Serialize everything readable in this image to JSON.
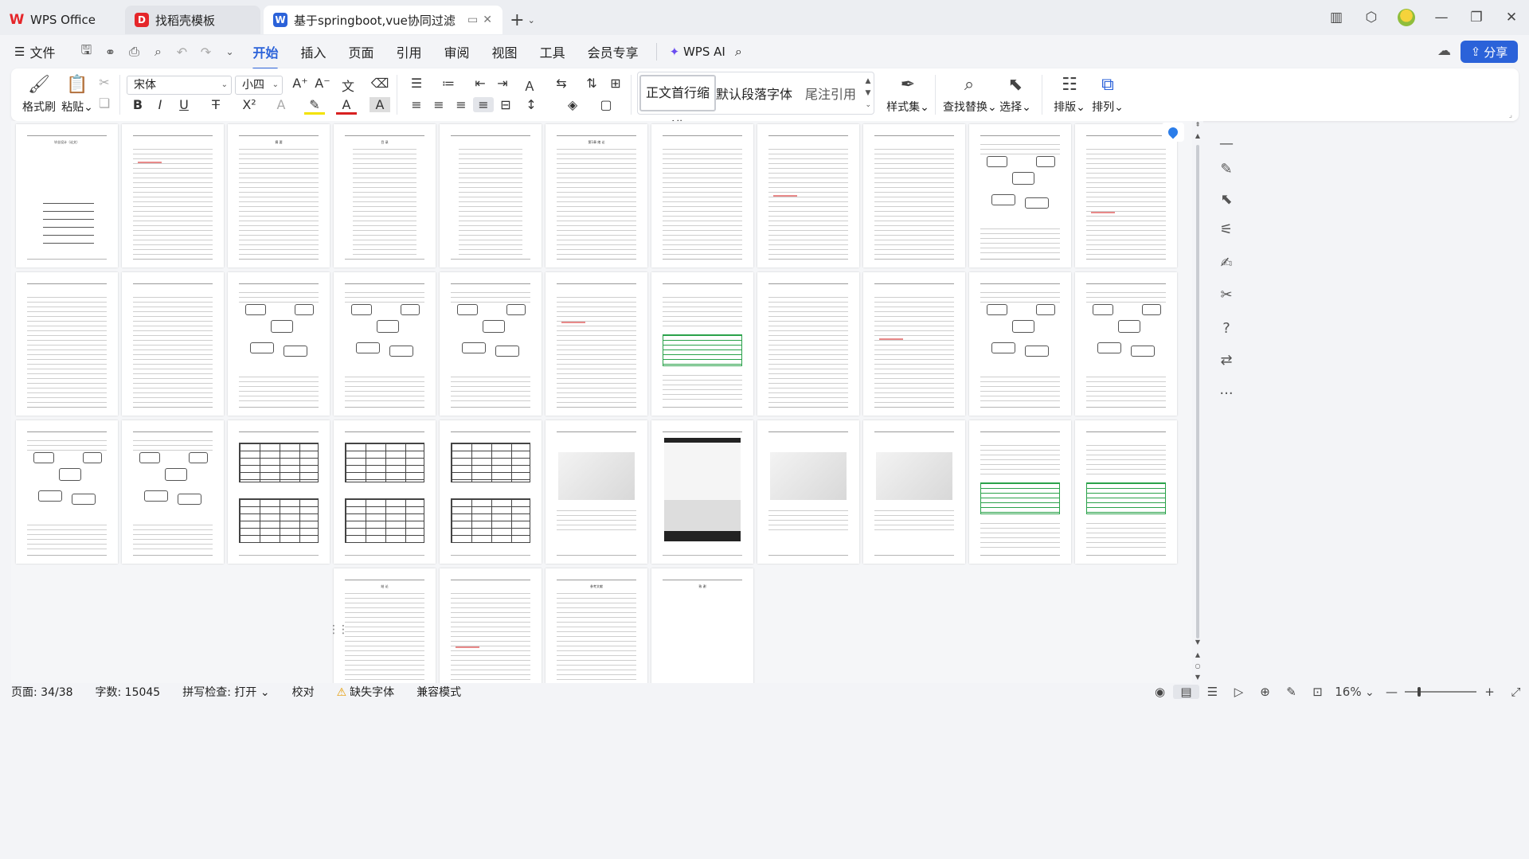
{
  "tabs": [
    {
      "label": "WPS Office",
      "logo": "W"
    },
    {
      "label": "找稻壳模板",
      "logo": "D"
    },
    {
      "label": "基于springboot,vue协同过滤",
      "logo": "W"
    }
  ],
  "menu": {
    "file": "文件",
    "items": [
      "开始",
      "插入",
      "页面",
      "引用",
      "审阅",
      "视图",
      "工具",
      "会员专享"
    ],
    "active": "开始",
    "wps_ai": "WPS AI",
    "share": "分享"
  },
  "ribbon": {
    "format_painter": "格式刷",
    "paste": "粘贴",
    "font_name": "宋体",
    "font_size": "小四",
    "styles": [
      "正文首行缩进",
      "默认段落字体",
      "尾注引用"
    ],
    "style_set": "样式集",
    "find_replace": "查找替换",
    "select": "选择",
    "layout": "排版",
    "arrange": "排列"
  },
  "pages": {
    "cover_title": "毕业设计（论文）",
    "abstract_title": "摘 要",
    "contents_title": "目 录",
    "chapter1": "第1章 绪 论",
    "chapter_summary": "结 论",
    "references": "参考文献",
    "thanks": "致 谢",
    "thumbnail_count": 37
  },
  "status": {
    "page": "页面: 34/38",
    "words": "字数: 15045",
    "spellcheck": "拼写检查: 打开",
    "proof": "校对",
    "missing_font": "缺失字体",
    "compat": "兼容模式",
    "zoom": "16%"
  },
  "colors": {
    "accent": "#2b62d9",
    "wps_red": "#e5262a",
    "warn": "#e59a00"
  }
}
